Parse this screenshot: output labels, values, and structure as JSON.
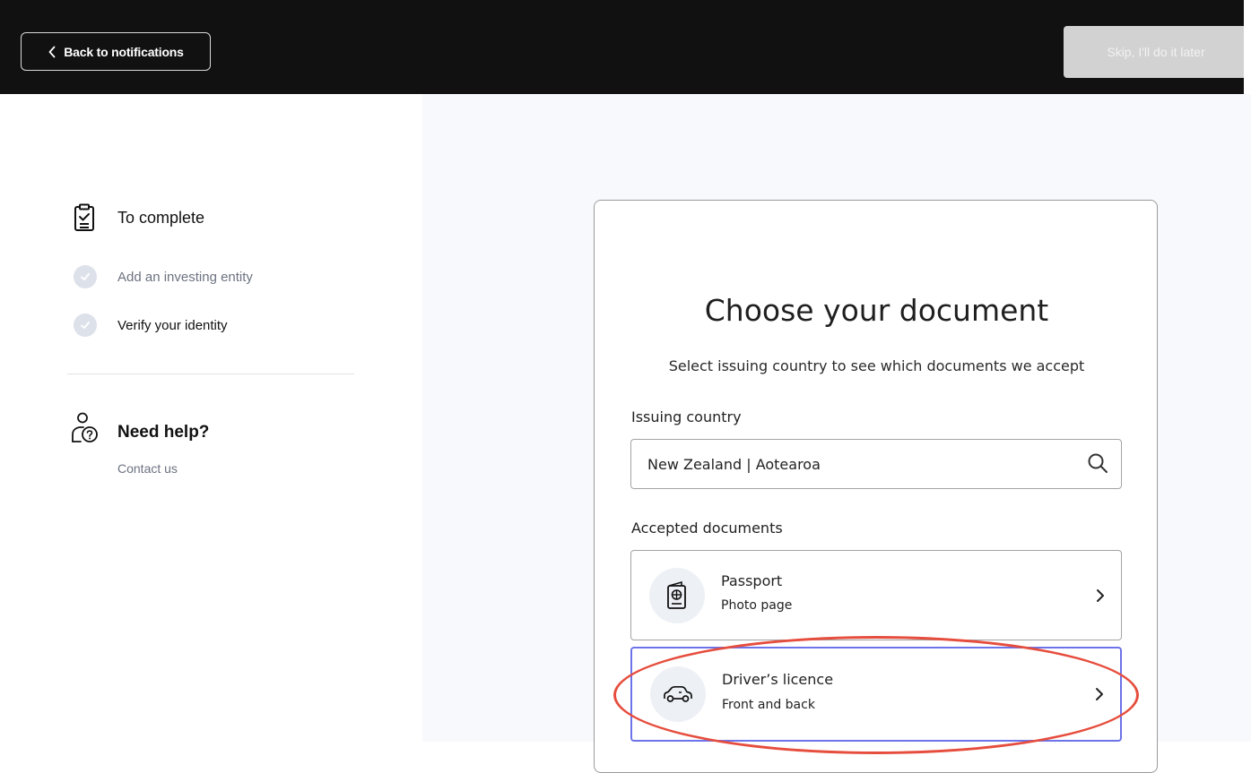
{
  "header": {
    "back_label": "Back to notifications",
    "skip_label": "Skip, I'll do it later"
  },
  "sidebar": {
    "to_complete_title": "To complete",
    "steps": [
      {
        "label": "Add an investing entity"
      },
      {
        "label": "Verify your identity"
      }
    ],
    "help_title": "Need help?",
    "contact_label": "Contact us"
  },
  "card": {
    "title": "Choose your document",
    "subtitle": "Select issuing country to see which documents we accept",
    "country_label": "Issuing country",
    "country_value": "New Zealand | Aotearoa",
    "accepted_label": "Accepted documents",
    "documents": [
      {
        "name": "Passport",
        "desc": "Photo page",
        "icon": "passport-icon"
      },
      {
        "name": "Driver’s licence",
        "desc": "Front and back",
        "icon": "car-icon"
      }
    ]
  },
  "colors": {
    "topbar": "#111111",
    "selected_border": "#6d73e8",
    "annotation": "#e64d3d"
  }
}
